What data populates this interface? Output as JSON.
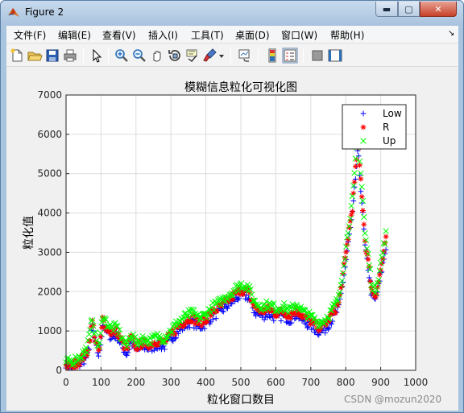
{
  "window": {
    "title": "Figure 2",
    "min_symbol": "▬",
    "max_symbol": "▢",
    "close_symbol": "✕"
  },
  "menu": {
    "items": [
      "文件(F)",
      "编辑(E)",
      "查看(V)",
      "插入(I)",
      "工具(T)",
      "桌面(D)",
      "窗口(W)",
      "帮助(H)"
    ],
    "dock_arrow": "↘"
  },
  "toolbar": {
    "icons": [
      "new-figure-icon",
      "open-icon",
      "save-icon",
      "print-icon",
      "select-arrow-icon",
      "zoom-in-icon",
      "zoom-out-icon",
      "pan-hand-icon",
      "rotate-3d-icon",
      "data-cursor-icon",
      "brush-icon",
      "brush-dropdown-icon",
      "link-plot-icon",
      "colorbar-icon",
      "legend-icon",
      "hide-plot-tools-icon",
      "show-plot-tools-icon"
    ]
  },
  "colors": {
    "low": "#0000ff",
    "r": "#ff0000",
    "up": "#00ff00",
    "axes_bg": "#ffffff",
    "figure_bg": "#f0f0f0",
    "grid": "#dddddd"
  },
  "chart_data": {
    "type": "scatter",
    "title": "模糊信息粒化可视化图",
    "xlabel": "粒化窗口数目",
    "ylabel": "粒化值",
    "xlim": [
      0,
      1000
    ],
    "ylim": [
      0,
      7000
    ],
    "xticks": [
      "0",
      "100",
      "200",
      "300",
      "400",
      "500",
      "600",
      "700",
      "800",
      "900",
      "1000"
    ],
    "yticks": [
      "0",
      "1000",
      "2000",
      "3000",
      "4000",
      "5000",
      "6000",
      "7000"
    ],
    "grid": true,
    "legend": {
      "position": "top-right",
      "entries": [
        "Low",
        "R",
        "Up"
      ]
    },
    "trend": [
      [
        0,
        120
      ],
      [
        20,
        140
      ],
      [
        40,
        250
      ],
      [
        60,
        450
      ],
      [
        70,
        900
      ],
      [
        75,
        1250
      ],
      [
        85,
        700
      ],
      [
        95,
        450
      ],
      [
        105,
        1300
      ],
      [
        115,
        1100
      ],
      [
        130,
        950
      ],
      [
        145,
        1000
      ],
      [
        160,
        700
      ],
      [
        175,
        500
      ],
      [
        185,
        850
      ],
      [
        200,
        600
      ],
      [
        220,
        700
      ],
      [
        240,
        650
      ],
      [
        260,
        750
      ],
      [
        280,
        700
      ],
      [
        300,
        900
      ],
      [
        320,
        1100
      ],
      [
        340,
        1250
      ],
      [
        360,
        1350
      ],
      [
        380,
        1200
      ],
      [
        400,
        1300
      ],
      [
        420,
        1500
      ],
      [
        440,
        1600
      ],
      [
        460,
        1750
      ],
      [
        480,
        1900
      ],
      [
        500,
        2050
      ],
      [
        520,
        2000
      ],
      [
        540,
        1600
      ],
      [
        560,
        1500
      ],
      [
        580,
        1550
      ],
      [
        600,
        1450
      ],
      [
        620,
        1500
      ],
      [
        640,
        1400
      ],
      [
        660,
        1550
      ],
      [
        680,
        1350
      ],
      [
        700,
        1250
      ],
      [
        720,
        1100
      ],
      [
        740,
        1150
      ],
      [
        760,
        1400
      ],
      [
        780,
        1700
      ],
      [
        790,
        2300
      ],
      [
        800,
        2900
      ],
      [
        810,
        3600
      ],
      [
        820,
        4200
      ],
      [
        830,
        5300
      ],
      [
        835,
        5800
      ],
      [
        840,
        5200
      ],
      [
        850,
        4000
      ],
      [
        855,
        3300
      ],
      [
        865,
        2700
      ],
      [
        875,
        2000
      ],
      [
        885,
        1900
      ],
      [
        895,
        2300
      ],
      [
        905,
        2800
      ],
      [
        915,
        3300
      ]
    ],
    "series": [
      {
        "name": "Low",
        "marker": "+",
        "offset": -90
      },
      {
        "name": "R",
        "marker": "*",
        "offset": 0
      },
      {
        "name": "Up",
        "marker": "x",
        "offset": 90
      }
    ]
  },
  "watermark": "CSDN @mozun2020"
}
